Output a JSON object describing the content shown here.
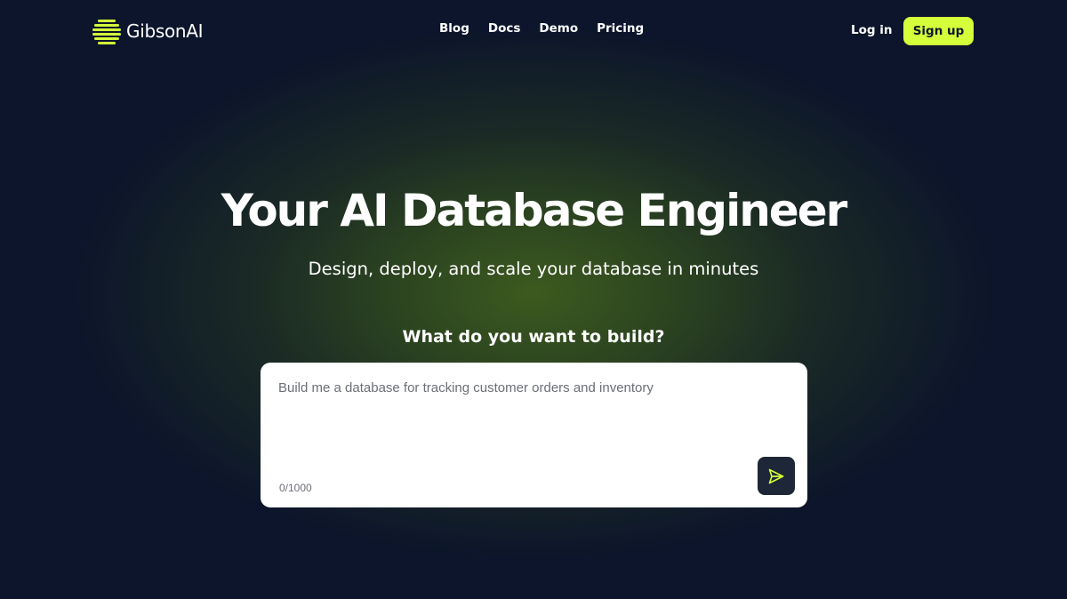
{
  "brand": {
    "name": "GibsonAI",
    "logo_icon": "striped-globe-icon",
    "accent_color": "#d4ff3a"
  },
  "nav": {
    "links": [
      "Blog",
      "Docs",
      "Demo",
      "Pricing"
    ],
    "login_label": "Log in",
    "signup_label": "Sign up"
  },
  "hero": {
    "title": "Your AI Database Engineer",
    "subtitle": "Design, deploy, and scale your database in minutes"
  },
  "prompt": {
    "label": "What do you want to build?",
    "placeholder": "Build me a database for tracking customer orders and inventory",
    "value": "",
    "counter": "0/1000",
    "send_icon": "send-icon"
  },
  "colors": {
    "background": "#0c152b",
    "glow": "#3d5a1f",
    "send_button": "#1d2738"
  }
}
